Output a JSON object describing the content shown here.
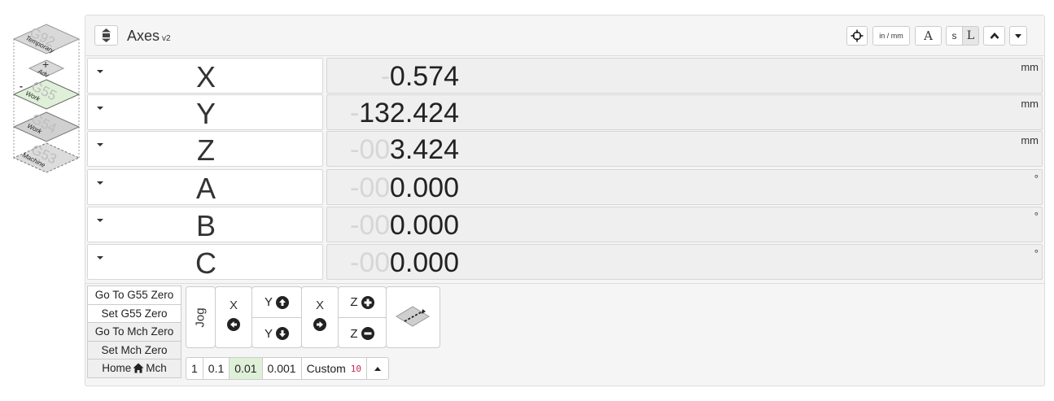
{
  "wcs_stack": {
    "layers": [
      {
        "code": "G92",
        "label": "Temporary",
        "state": "inactive"
      },
      {
        "code": "+",
        "label": "Adv",
        "state": "inactive"
      },
      {
        "code": "G55",
        "label": "Work",
        "state": "active"
      },
      {
        "code": "G54",
        "label": "Work",
        "state": "inactive"
      },
      {
        "code": "G53",
        "label": "Machine",
        "state": "inactive"
      }
    ],
    "minus": "-"
  },
  "header": {
    "title": "Axes",
    "version": "v2",
    "buttons": {
      "toolpath_icon": "crosshair-icon",
      "units_label": "in / mm",
      "a_label": "A",
      "s_label": "s",
      "l_label": "L"
    }
  },
  "axes": [
    {
      "name": "X",
      "ghost": "-",
      "value": "0.574",
      "unit": "mm"
    },
    {
      "name": "Y",
      "ghost": "-",
      "value": "132.424",
      "unit": "mm"
    },
    {
      "name": "Z",
      "ghost": "-00",
      "value": "3.424",
      "unit": "mm"
    },
    {
      "name": "A",
      "ghost": "-00",
      "value": "0.000",
      "unit": "°"
    },
    {
      "name": "B",
      "ghost": "-00",
      "value": "0.000",
      "unit": "°"
    },
    {
      "name": "C",
      "ghost": "-00",
      "value": "0.000",
      "unit": "°"
    }
  ],
  "zero_buttons": {
    "goto_g55": "Go To G55 Zero",
    "set_g55": "Set G55 Zero",
    "goto_mch": "Go To Mch Zero",
    "set_mch": "Set Mch Zero",
    "home_left": "Home",
    "home_right": "Mch"
  },
  "jog": {
    "label": "Jog",
    "x_neg": "X",
    "y_pos": "Y",
    "y_neg": "Y",
    "x_pos": "X",
    "z_pos": "Z",
    "z_neg": "Z"
  },
  "step_sizes": {
    "options": [
      "1",
      "0.1",
      "0.01",
      "0.001"
    ],
    "active": "0.01",
    "custom_label": "Custom",
    "custom_value": "10"
  },
  "colors": {
    "active_layer": "#dff0d8",
    "inactive_layer": "#d6d6d6",
    "active_step": "#dff0d8"
  }
}
